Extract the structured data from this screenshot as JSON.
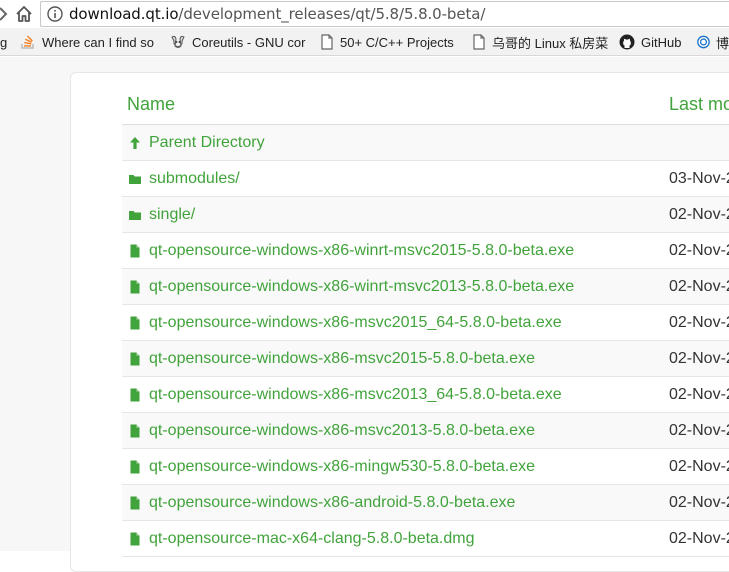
{
  "browser": {
    "url_host": "download.qt.io",
    "url_path": "/development_releases/qt/5.8/5.8.0-beta/"
  },
  "bookmarks": [
    {
      "label": "g",
      "icon": "partial-icon"
    },
    {
      "label": "Where can I find so",
      "icon": "stackoverflow-icon"
    },
    {
      "label": "Coreutils - GNU cor",
      "icon": "gnu-icon"
    },
    {
      "label": "50+ C/C++ Projects",
      "icon": "page-icon"
    },
    {
      "label": "乌哥的 Linux 私房菜",
      "icon": "page-icon"
    },
    {
      "label": "GitHub",
      "icon": "github-icon"
    },
    {
      "label": "博",
      "icon": "blog-icon"
    }
  ],
  "listing": {
    "header_name": "Name",
    "header_modified": "Last mo",
    "rows": [
      {
        "name": "Parent Directory",
        "date": "",
        "type": "parent"
      },
      {
        "name": "submodules/",
        "date": "03-Nov-2",
        "type": "folder"
      },
      {
        "name": "single/",
        "date": "02-Nov-2",
        "type": "folder"
      },
      {
        "name": "qt-opensource-windows-x86-winrt-msvc2015-5.8.0-beta.exe",
        "date": "02-Nov-2",
        "type": "file"
      },
      {
        "name": "qt-opensource-windows-x86-winrt-msvc2013-5.8.0-beta.exe",
        "date": "02-Nov-2",
        "type": "file"
      },
      {
        "name": "qt-opensource-windows-x86-msvc2015_64-5.8.0-beta.exe",
        "date": "02-Nov-2",
        "type": "file"
      },
      {
        "name": "qt-opensource-windows-x86-msvc2015-5.8.0-beta.exe",
        "date": "02-Nov-2",
        "type": "file"
      },
      {
        "name": "qt-opensource-windows-x86-msvc2013_64-5.8.0-beta.exe",
        "date": "02-Nov-2",
        "type": "file"
      },
      {
        "name": "qt-opensource-windows-x86-msvc2013-5.8.0-beta.exe",
        "date": "02-Nov-2",
        "type": "file"
      },
      {
        "name": "qt-opensource-windows-x86-mingw530-5.8.0-beta.exe",
        "date": "02-Nov-2",
        "type": "file"
      },
      {
        "name": "qt-opensource-windows-x86-android-5.8.0-beta.exe",
        "date": "02-Nov-2",
        "type": "file"
      },
      {
        "name": "qt-opensource-mac-x64-clang-5.8.0-beta.dmg",
        "date": "02-Nov-2",
        "type": "file"
      }
    ]
  },
  "colors": {
    "accent": "#41a33b",
    "text": "#333333"
  }
}
